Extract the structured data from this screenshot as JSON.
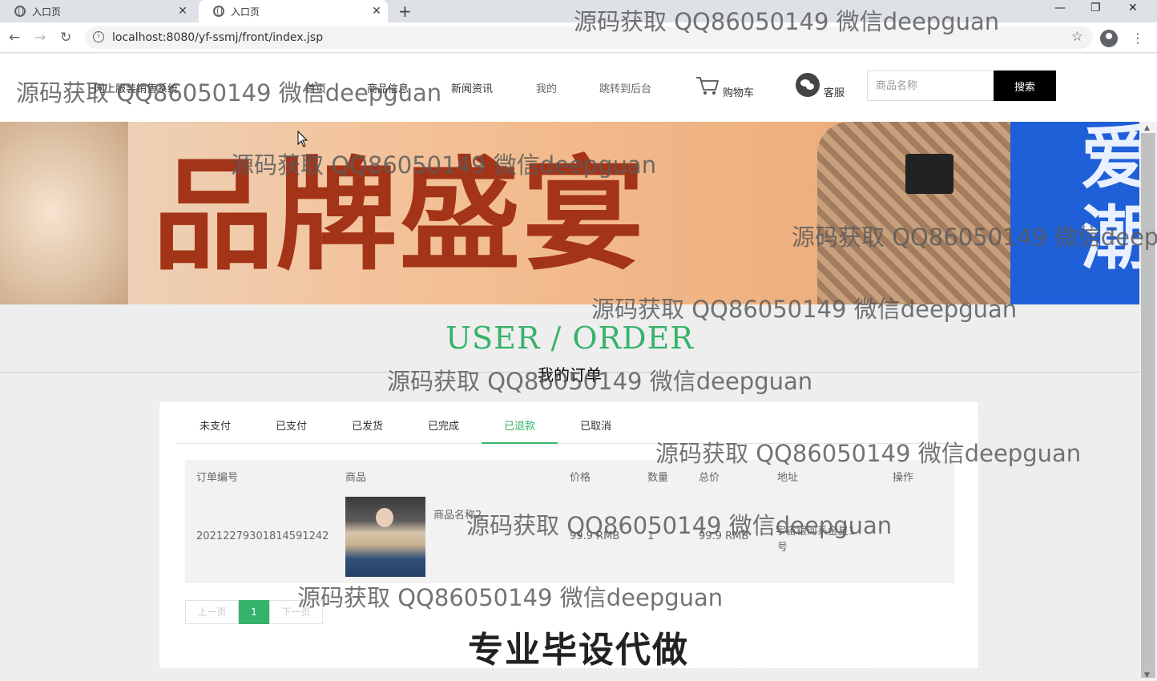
{
  "browser": {
    "tabs": [
      {
        "title": "入口页",
        "close": "✕"
      },
      {
        "title": "入口页",
        "close": "✕"
      }
    ],
    "new_tab": "+",
    "window_controls": {
      "minimize": "—",
      "maximize": "❐",
      "close": "✕"
    },
    "back": "←",
    "forward": "→",
    "reload": "↻",
    "site_info": "i",
    "url": "localhost:8080/yf-ssmj/front/index.jsp",
    "bookmark": "☆",
    "menu": "⋮"
  },
  "site": {
    "brand": "网上服装销售系统",
    "nav": [
      "首页",
      "商品信息",
      "新闻资讯",
      "我的",
      "跳转到后台"
    ],
    "cart_label": "购物车",
    "service_label": "客服",
    "search_placeholder": "商品名称",
    "search_button": "搜索"
  },
  "banner": {
    "main_text": "品牌盛宴",
    "side_text": "爱潮"
  },
  "section": {
    "title_en": "USER / ORDER",
    "title_cn": "我的订单"
  },
  "order_tabs": [
    "未支付",
    "已支付",
    "已发货",
    "已完成",
    "已退款",
    "已取消"
  ],
  "active_tab": "已退款",
  "table": {
    "headers": [
      "订单编号",
      "商品",
      "价格",
      "数量",
      "总价",
      "地址",
      "操作"
    ],
    "rows": [
      {
        "order_no": "20212279301814591242",
        "product_name": "商品名称2",
        "price": "99.9 RMB",
        "qty": "1",
        "total": "99.9 RMB",
        "address_line1": "宇宙银河系金星1",
        "address_line2": "号",
        "action": ""
      }
    ]
  },
  "pager": {
    "prev": "上一页",
    "current": "1",
    "next": "下一页"
  },
  "promo": "专业毕设代做",
  "watermark": "源码获取 QQ86050149 微信deepguan",
  "colors": {
    "accent": "#36b36b",
    "banner_red": "#a33418",
    "search_btn": "#000000"
  }
}
